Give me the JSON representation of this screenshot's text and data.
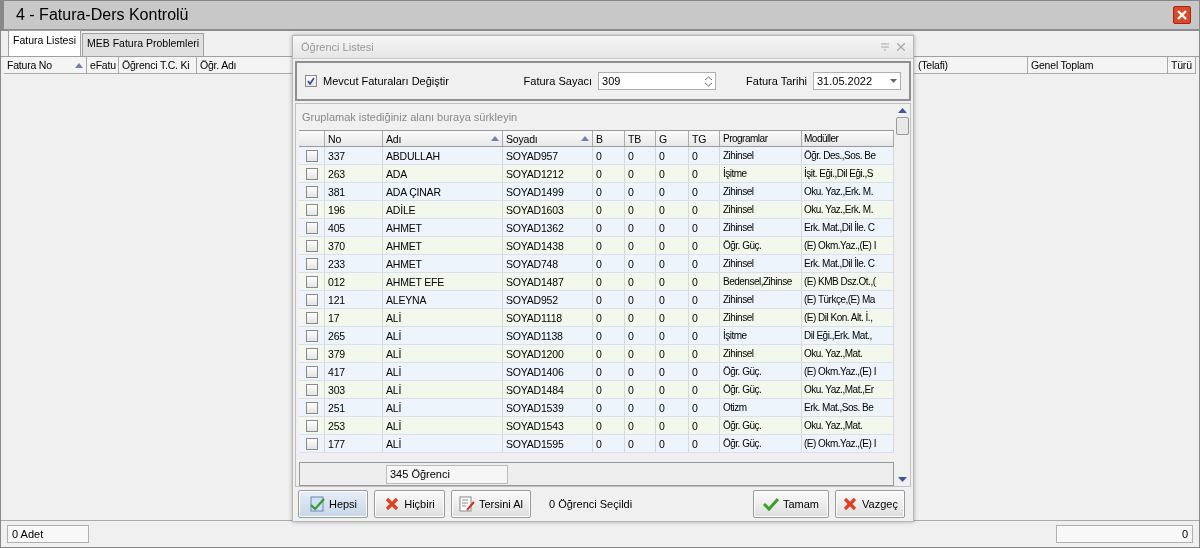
{
  "window": {
    "title": "4 - Fatura-Ders Kontrolü"
  },
  "tabs": [
    {
      "label": "Fatura Listesi",
      "selected": true
    },
    {
      "label": "MEB Fatura Problemleri",
      "selected": false
    }
  ],
  "invoice_table": {
    "columns_left": [
      {
        "label": "Fatura No",
        "sorted": true
      },
      {
        "label": "eFatu",
        "sorted": false
      },
      {
        "label": "Öğrenci T.C. Ki",
        "sorted": false
      },
      {
        "label": "Öğr. Adı",
        "sorted": false
      }
    ],
    "columns_right": [
      {
        "label": "(Telafi)"
      },
      {
        "label": "Genel Toplam"
      },
      {
        "label": "Türü"
      }
    ]
  },
  "status_bar": {
    "count": "0 Adet",
    "total": "0"
  },
  "dialog": {
    "title": "Öğrenci Listesi",
    "active": false,
    "replace_invoices": {
      "label": "Mevcut Faturaları Değiştir",
      "checked": true
    },
    "counter": {
      "label": "Fatura Sayacı",
      "value": "309"
    },
    "date": {
      "label": "Fatura Tarihi",
      "value": "31.05.2022"
    },
    "group_hint": "Gruplamak istediğiniz alanı buraya sürkleyin",
    "columns": [
      {
        "label": "No",
        "sorted": false
      },
      {
        "label": "Adı",
        "sorted": true
      },
      {
        "label": "Soyadı",
        "sorted": true
      },
      {
        "label": "B",
        "sorted": false
      },
      {
        "label": "TB",
        "sorted": false
      },
      {
        "label": "G",
        "sorted": false
      },
      {
        "label": "TG",
        "sorted": false
      },
      {
        "label": "Programlar",
        "sorted": false
      },
      {
        "label": "Modüller",
        "sorted": false
      }
    ],
    "rows": [
      {
        "checked": false,
        "cells": [
          "337",
          "ABDULLAH",
          "SOYAD957",
          "0",
          "0",
          "0",
          "0",
          "Zihinsel",
          "Öğr. Des.,Sos. Be"
        ]
      },
      {
        "checked": false,
        "cells": [
          "263",
          "ADA",
          "SOYAD1212",
          "0",
          "0",
          "0",
          "0",
          "İşitme",
          "İşit. Eği.,Dil Eği.,S"
        ]
      },
      {
        "checked": false,
        "cells": [
          "381",
          "ADA ÇINAR",
          "SOYAD1499",
          "0",
          "0",
          "0",
          "0",
          "Zihinsel",
          "Oku. Yaz.,Erk. M."
        ]
      },
      {
        "checked": false,
        "cells": [
          "196",
          "ADİLE",
          "SOYAD1603",
          "0",
          "0",
          "0",
          "0",
          "Zihinsel",
          "Oku. Yaz.,Erk. M."
        ]
      },
      {
        "checked": false,
        "cells": [
          "405",
          "AHMET",
          "SOYAD1362",
          "0",
          "0",
          "0",
          "0",
          "Zihinsel",
          "Erk. Mat.,Dil İle. C"
        ]
      },
      {
        "checked": false,
        "cells": [
          "370",
          "AHMET",
          "SOYAD1438",
          "0",
          "0",
          "0",
          "0",
          "Öğr. Güç.",
          "(E) Okm.Yaz.,(E) I"
        ]
      },
      {
        "checked": false,
        "cells": [
          "233",
          "AHMET",
          "SOYAD748",
          "0",
          "0",
          "0",
          "0",
          "Zihinsel",
          "Erk. Mat.,Dil İle. C"
        ]
      },
      {
        "checked": false,
        "cells": [
          "012",
          "AHMET EFE",
          "SOYAD1487",
          "0",
          "0",
          "0",
          "0",
          "Bedensel,Zihinse",
          "(E) KMB Dsz.Ot.,("
        ]
      },
      {
        "checked": false,
        "cells": [
          "121",
          "ALEYNA",
          "SOYAD952",
          "0",
          "0",
          "0",
          "0",
          "Zihinsel",
          "(E) Türkçe,(E) Ma"
        ]
      },
      {
        "checked": false,
        "cells": [
          "17",
          "ALİ",
          "SOYAD1118",
          "0",
          "0",
          "0",
          "0",
          "Zihinsel",
          "(E) Dil Kon. Alt. İ.,"
        ]
      },
      {
        "checked": false,
        "cells": [
          "265",
          "ALİ",
          "SOYAD1138",
          "0",
          "0",
          "0",
          "0",
          "İşitme",
          "Dil Eği.,Erk. Mat.,"
        ]
      },
      {
        "checked": false,
        "cells": [
          "379",
          "ALİ",
          "SOYAD1200",
          "0",
          "0",
          "0",
          "0",
          "Zihinsel",
          "Oku. Yaz.,Mat."
        ]
      },
      {
        "checked": false,
        "cells": [
          "417",
          "ALİ",
          "SOYAD1406",
          "0",
          "0",
          "0",
          "0",
          "Öğr. Güç.",
          "(E) Okm.Yaz.,(E) I"
        ]
      },
      {
        "checked": false,
        "cells": [
          "303",
          "ALİ",
          "SOYAD1484",
          "0",
          "0",
          "0",
          "0",
          "Öğr. Güç.",
          "Oku. Yaz.,Mat.,Er"
        ]
      },
      {
        "checked": false,
        "cells": [
          "251",
          "ALİ",
          "SOYAD1539",
          "0",
          "0",
          "0",
          "0",
          "Otizm",
          "Erk. Mat.,Sos. Be"
        ]
      },
      {
        "checked": false,
        "cells": [
          "253",
          "ALİ",
          "SOYAD1543",
          "0",
          "0",
          "0",
          "0",
          "Öğr. Güç.",
          "Oku. Yaz.,Mat."
        ]
      },
      {
        "checked": false,
        "cells": [
          "177",
          "ALİ",
          "SOYAD1595",
          "0",
          "0",
          "0",
          "0",
          "Öğr. Güç.",
          "(E) Okm.Yaz.,(E) I"
        ]
      }
    ],
    "footer_count": "345 Öğrenci",
    "left_buttons": [
      {
        "kind": "all",
        "label": "Hepsi",
        "selected": true
      },
      {
        "kind": "none",
        "label": "Hiçbiri",
        "selected": false
      },
      {
        "kind": "invert",
        "label": "Tersini Al",
        "selected": false
      }
    ],
    "selection_text": "0 Öğrenci Seçildi",
    "right_buttons": [
      {
        "kind": "ok",
        "label": "Tamam",
        "selected": false
      },
      {
        "kind": "cancel",
        "label": "Vazgeç",
        "selected": false
      }
    ]
  }
}
